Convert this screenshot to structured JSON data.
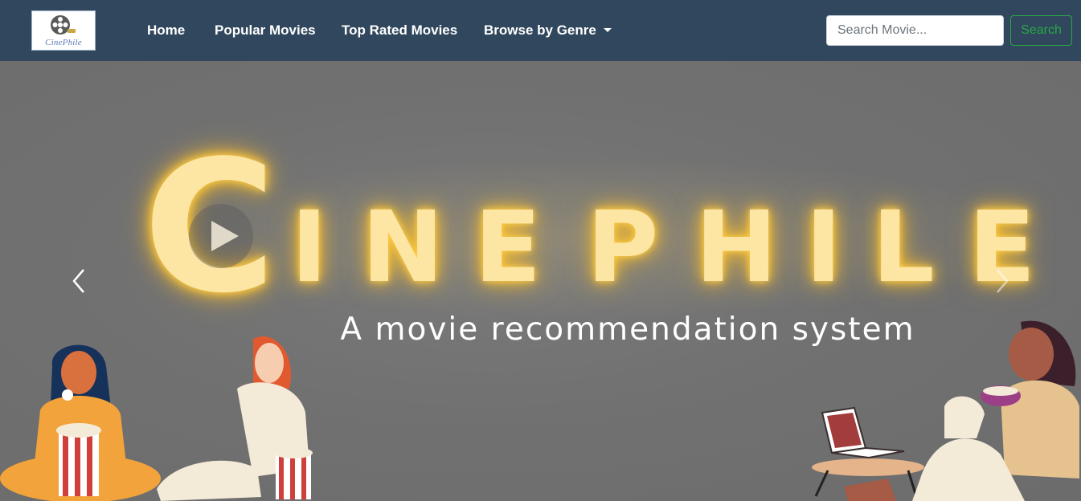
{
  "navbar": {
    "logo_text": "CinePhile",
    "links": {
      "home": "Home",
      "popular": "Popular Movies",
      "top_rated": "Top Rated Movies",
      "genre": "Browse by Genre"
    },
    "search": {
      "placeholder": "Search Movie...",
      "button_label": "Search"
    }
  },
  "hero": {
    "title_first_letter": "C",
    "title_letters": [
      "I",
      "N",
      "E",
      "P",
      "H",
      "I",
      "L",
      "E"
    ],
    "subtitle": "A movie recommendation system",
    "icons": {
      "play": "play-icon",
      "prev": "chevron-left-icon",
      "next": "chevron-right-icon"
    }
  },
  "colors": {
    "navbar_bg": "#31475e",
    "hero_bg": "#707070",
    "title_glow": "#fde6a4",
    "search_accent": "#28a745"
  }
}
